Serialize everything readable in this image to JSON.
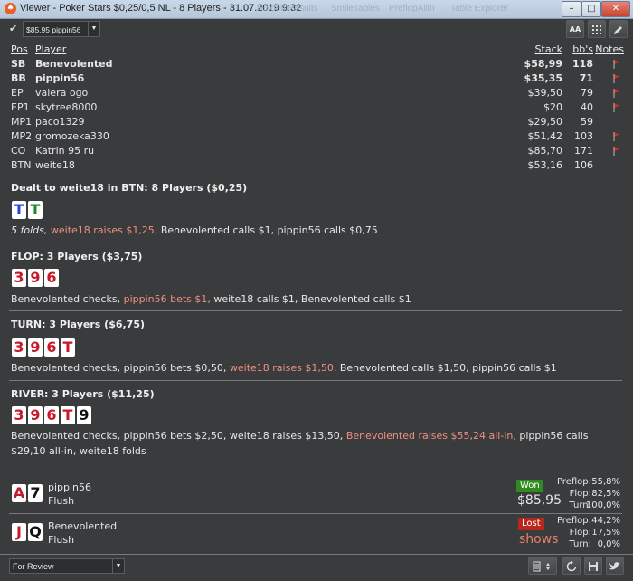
{
  "window": {
    "title": "Viewer - Poker Stars $0,25/0,5 NL - 8 Players - 31.07.2019 9:32",
    "ghost_tabs": [
      "HoldemResults",
      "SmileTables",
      "PreflopAllin",
      "Table Explorer"
    ]
  },
  "toolbar": {
    "selector_value": "$85,95 pippin56",
    "buttons": [
      "AA",
      "grid",
      "edit"
    ]
  },
  "players_header": {
    "pos": "Pos",
    "player": "Player",
    "stack": "Stack",
    "bbs": "bb's",
    "notes": "Notes"
  },
  "players": [
    {
      "pos": "SB",
      "name": "Benevolented",
      "stack": "$58,99",
      "bb": "118",
      "bold": true,
      "flag": true
    },
    {
      "pos": "BB",
      "name": "pippin56",
      "stack": "$35,35",
      "bb": "71",
      "bold": true,
      "flag": true
    },
    {
      "pos": "EP",
      "name": "valera ogo",
      "stack": "$39,50",
      "bb": "79",
      "bold": false,
      "flag": true
    },
    {
      "pos": "EP1",
      "name": "skytree8000",
      "stack": "$20",
      "bb": "40",
      "bold": false,
      "flag": true
    },
    {
      "pos": "MP1",
      "name": "paco1329",
      "stack": "$29,50",
      "bb": "59",
      "bold": false,
      "flag": false
    },
    {
      "pos": "MP2",
      "name": "gromozeka330",
      "stack": "$51,42",
      "bb": "103",
      "bold": false,
      "flag": true
    },
    {
      "pos": "CO",
      "name": "Katrin 95 ru",
      "stack": "$85,70",
      "bb": "171",
      "bold": false,
      "flag": true
    },
    {
      "pos": "BTN",
      "name": "weite18",
      "stack": "$53,16",
      "bb": "106",
      "bold": false,
      "flag": false
    }
  ],
  "colors": {
    "highlight": "#f09080",
    "won": "#2f8a1f",
    "lost": "#b7281c",
    "flag": "#d42a1e",
    "background": "#3a3b3d"
  },
  "preflop": {
    "title": "Dealt to weite18 in BTN: 8 Players ($0,25)",
    "cards": [
      {
        "r": "T",
        "s": "d"
      },
      {
        "r": "T",
        "s": "c"
      }
    ],
    "action": {
      "italic": "5 folds,",
      "hl": "weite18 raises $1,25,",
      "rest": "Benevolented calls $1, pippin56 calls $0,75"
    }
  },
  "flop": {
    "title": "FLOP: 3 Players ($3,75)",
    "cards": [
      {
        "r": "3",
        "s": "h"
      },
      {
        "r": "9",
        "s": "h"
      },
      {
        "r": "6",
        "s": "h"
      }
    ],
    "action": {
      "a": "Benevolented checks,",
      "hl": "pippin56 bets $1,",
      "b": "weite18 calls $1, Benevolented calls $1"
    }
  },
  "turn": {
    "title": "TURN: 3 Players ($6,75)",
    "cards": [
      {
        "r": "3",
        "s": "h"
      },
      {
        "r": "9",
        "s": "h"
      },
      {
        "r": "6",
        "s": "h"
      },
      {
        "r": "T",
        "s": "h"
      }
    ],
    "action": {
      "a": "Benevolented checks, pippin56 bets $0,50,",
      "hl": "weite18 raises $1,50,",
      "b": "Benevolented calls $1,50, pippin56 calls $1"
    }
  },
  "river": {
    "title": "RIVER: 3 Players ($11,25)",
    "cards": [
      {
        "r": "3",
        "s": "h"
      },
      {
        "r": "9",
        "s": "h"
      },
      {
        "r": "6",
        "s": "h"
      },
      {
        "r": "T",
        "s": "h"
      },
      {
        "r": "9",
        "s": "s"
      }
    ],
    "action": {
      "a": "Benevolented checks, pippin56 bets $2,50, weite18 raises $13,50,",
      "hl": "Benevolented raises $55,24 all-in,",
      "b": "pippin56 calls $29,10 all-in, weite18 folds"
    }
  },
  "results": [
    {
      "cards": [
        {
          "r": "A",
          "s": "h"
        },
        {
          "r": "7",
          "s": "s"
        }
      ],
      "name": "pippin56",
      "hand": "Flush",
      "badge": "Won",
      "amount": "$85,95",
      "stats": [
        {
          "l": "Preflop:",
          "v": "55,8%"
        },
        {
          "l": "Flop:",
          "v": "82,5%"
        },
        {
          "l": "Turn:",
          "v": "100,0%"
        }
      ]
    },
    {
      "cards": [
        {
          "r": "J",
          "s": "h"
        },
        {
          "r": "Q",
          "s": "s"
        }
      ],
      "name": "Benevolented",
      "hand": "Flush",
      "badge": "Lost",
      "amount": "shows",
      "stats": [
        {
          "l": "Preflop:",
          "v": "44,2%"
        },
        {
          "l": "Flop:",
          "v": "17,5%"
        },
        {
          "l": "Turn:",
          "v": "0,0%"
        }
      ]
    }
  ],
  "bottombar": {
    "filter_value": "For Review"
  }
}
